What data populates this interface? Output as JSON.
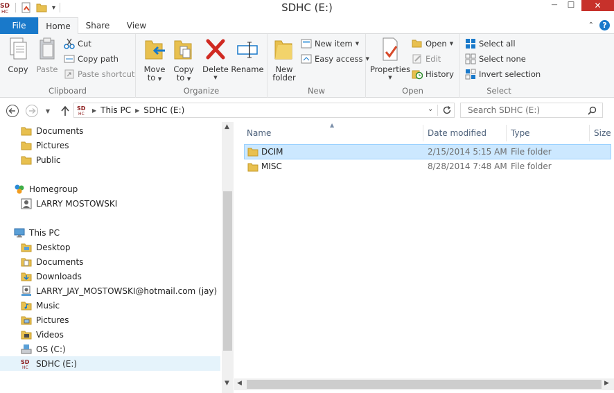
{
  "window": {
    "title": "SDHC (E:)",
    "minimize": "—",
    "maximize": "☐",
    "close": "✕"
  },
  "ribbon_tabs": {
    "file": "File",
    "home": "Home",
    "share": "Share",
    "view": "View"
  },
  "clipboard": {
    "copy": "Copy",
    "paste": "Paste",
    "cut": "Cut",
    "copy_path": "Copy path",
    "paste_shortcut": "Paste shortcut",
    "label": "Clipboard"
  },
  "organize": {
    "move_to_1": "Move",
    "move_to_2": "to",
    "copy_to_1": "Copy",
    "copy_to_2": "to",
    "delete": "Delete",
    "rename": "Rename",
    "label": "Organize"
  },
  "new": {
    "new_folder_1": "New",
    "new_folder_2": "folder",
    "new_item": "New item",
    "easy_access": "Easy access",
    "label": "New"
  },
  "open": {
    "properties": "Properties",
    "open": "Open",
    "edit": "Edit",
    "history": "History",
    "label": "Open"
  },
  "select": {
    "select_all": "Select all",
    "select_none": "Select none",
    "invert": "Invert selection",
    "label": "Select"
  },
  "address": {
    "this_pc": "This PC",
    "drive": "SDHC (E:)",
    "search_placeholder": "Search SDHC (E:)"
  },
  "nav": {
    "items": [
      {
        "label": "Documents"
      },
      {
        "label": "Pictures"
      },
      {
        "label": "Public"
      },
      {
        "label": "Homegroup"
      },
      {
        "label": "LARRY MOSTOWSKI"
      },
      {
        "label": "This PC"
      },
      {
        "label": "Desktop"
      },
      {
        "label": "Documents"
      },
      {
        "label": "Downloads"
      },
      {
        "label": "LARRY_JAY_MOSTOWSKI@hotmail.com (jay)"
      },
      {
        "label": "Music"
      },
      {
        "label": "Pictures"
      },
      {
        "label": "Videos"
      },
      {
        "label": "OS (C:)"
      },
      {
        "label": "SDHC (E:)"
      }
    ]
  },
  "columns": {
    "name": "Name",
    "date": "Date modified",
    "type": "Type",
    "size": "Size"
  },
  "files": [
    {
      "name": "DCIM",
      "date": "2/15/2014 5:15 AM",
      "type": "File folder"
    },
    {
      "name": "MISC",
      "date": "8/28/2014 7:48 AM",
      "type": "File folder"
    }
  ],
  "colors": {
    "accent": "#1979ca",
    "folder": "#e8c04f",
    "selection": "#cce8ff",
    "close": "#c7312b"
  }
}
